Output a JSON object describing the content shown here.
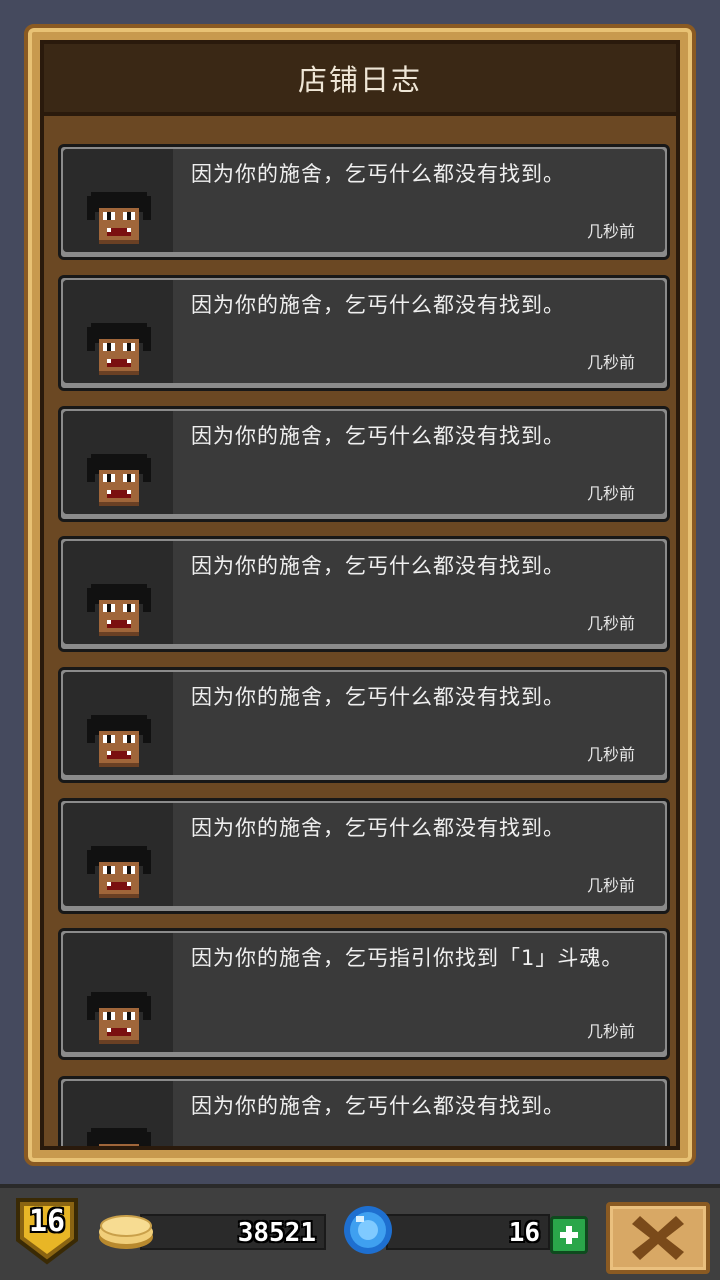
{
  "panel": {
    "title": "店铺日志"
  },
  "entries": [
    {
      "text": "因为你的施舍，乞丐什么都没有找到。",
      "time": "几秒前",
      "avatar": "beggar-face-icon"
    },
    {
      "text": "因为你的施舍，乞丐什么都没有找到。",
      "time": "几秒前",
      "avatar": "beggar-face-icon"
    },
    {
      "text": "因为你的施舍，乞丐什么都没有找到。",
      "time": "几秒前",
      "avatar": "beggar-face-icon"
    },
    {
      "text": "因为你的施舍，乞丐什么都没有找到。",
      "time": "几秒前",
      "avatar": "beggar-face-icon"
    },
    {
      "text": "因为你的施舍，乞丐什么都没有找到。",
      "time": "几秒前",
      "avatar": "beggar-face-icon"
    },
    {
      "text": "因为你的施舍，乞丐什么都没有找到。",
      "time": "几秒前",
      "avatar": "beggar-face-icon"
    },
    {
      "text": "因为你的施舍，乞丐指引你找到「1」斗魂。",
      "time": "几秒前",
      "avatar": "beggar-face-icon"
    },
    {
      "text": "因为你的施舍，乞丐什么都没有找到。",
      "time": "",
      "avatar": "beggar-face-icon"
    }
  ],
  "bottom_bar": {
    "level": "16",
    "gold": "38521",
    "gems": "16",
    "gold_icon": "gold-coin-icon",
    "gem_icon": "blue-gem-icon",
    "plus_icon": "plus-icon",
    "close_icon": "close-x-icon"
  },
  "colors": {
    "panel_gold": "#c89a4e",
    "panel_brown": "#6b4823",
    "entry_bg": "#3a3a3a",
    "plus_green": "#2aa64a"
  }
}
